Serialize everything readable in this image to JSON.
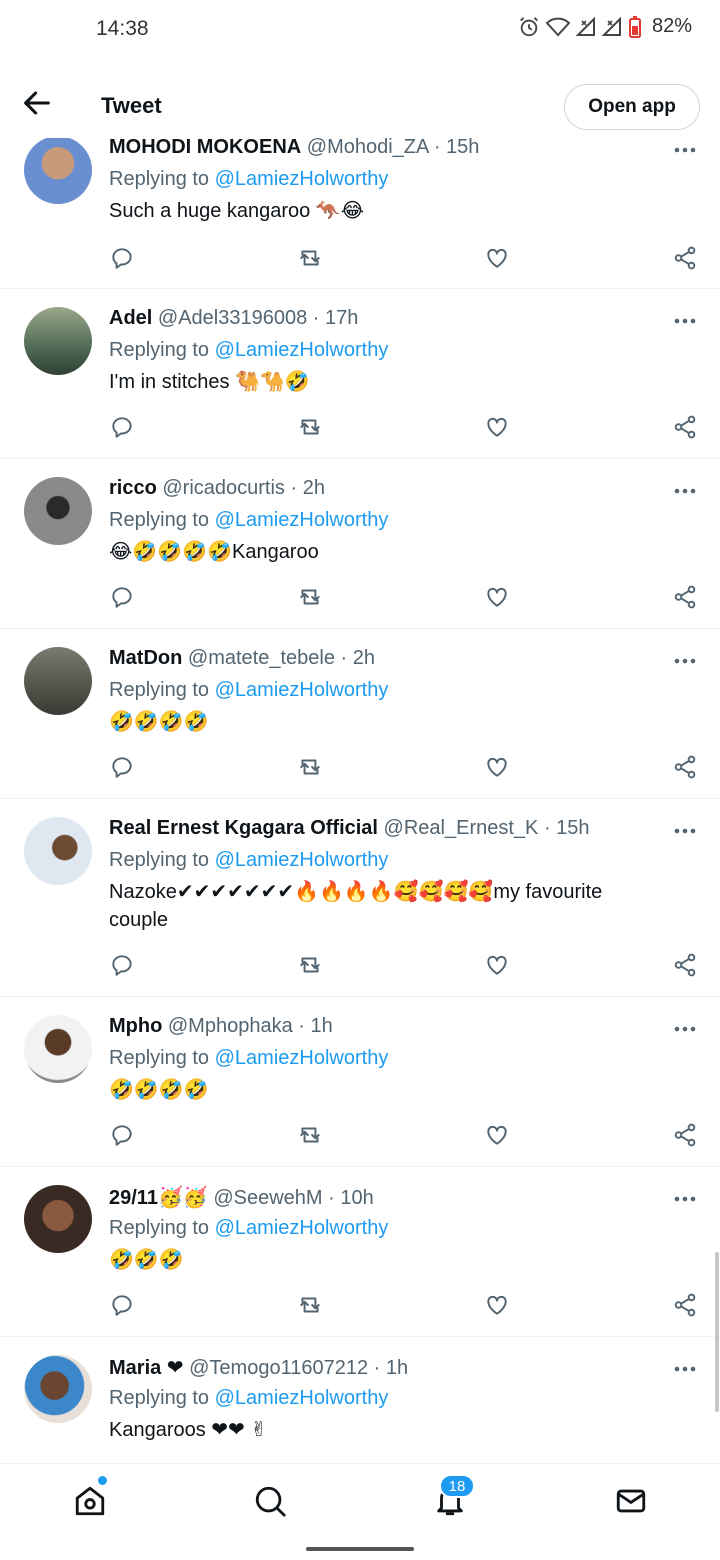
{
  "status": {
    "time": "14:38",
    "battery": "82%",
    "icons": [
      "alarm-icon",
      "wifi-icon",
      "signal-icon",
      "signal-icon",
      "battery-icon"
    ]
  },
  "header": {
    "title": "Tweet",
    "open_app": "Open app"
  },
  "replying_label": "Replying to",
  "replying_mention": "@LamiezHolworthy",
  "tweets": [
    {
      "name": "MOHODI MOKOENA",
      "handle": "@Mohodi_ZA",
      "time": "· 15h",
      "text": "Such a huge kangaroo 🦘😂"
    },
    {
      "name": "Adel",
      "handle": "@Adel33196008",
      "time": "· 17h",
      "text": "I'm in stitches 🐫🐪🤣"
    },
    {
      "name": "ricco",
      "handle": "@ricadocurtis",
      "time": "· 2h",
      "text": "😂🤣🤣🤣🤣Kangaroo"
    },
    {
      "name": "MatDon",
      "handle": "@matete_tebele",
      "time": "· 2h",
      "text": "🤣🤣🤣🤣"
    },
    {
      "name": "Real Ernest Kgagara Official",
      "handle": "@Real_Ernest_K",
      "time": "· 15h",
      "text": "Nazoke✔✔✔✔✔✔✔🔥🔥🔥🔥🥰🥰🥰🥰my favourite couple"
    },
    {
      "name": "Mpho",
      "handle": "@Mphophaka",
      "time": "· 1h",
      "text": "🤣🤣🤣🤣"
    },
    {
      "name": "29/11🥳🥳",
      "handle": "@SeewehM",
      "time": "· 10h",
      "text": "🤣🤣🤣"
    },
    {
      "name": "Maria ❤",
      "handle": "@Temogo11607212",
      "time": "· 1h",
      "text": "Kangaroos ❤❤ ✌"
    }
  ],
  "actions": [
    "reply-icon",
    "retweet-icon",
    "like-icon",
    "share-icon"
  ],
  "bottom_nav": {
    "items": [
      "home-icon",
      "search-icon",
      "notifications-icon",
      "messages-icon"
    ],
    "notification_count": "18"
  },
  "colors": {
    "accent": "#1d9bf0",
    "text": "#0f1419",
    "secondary": "#536471",
    "divider": "#eff3f4"
  }
}
